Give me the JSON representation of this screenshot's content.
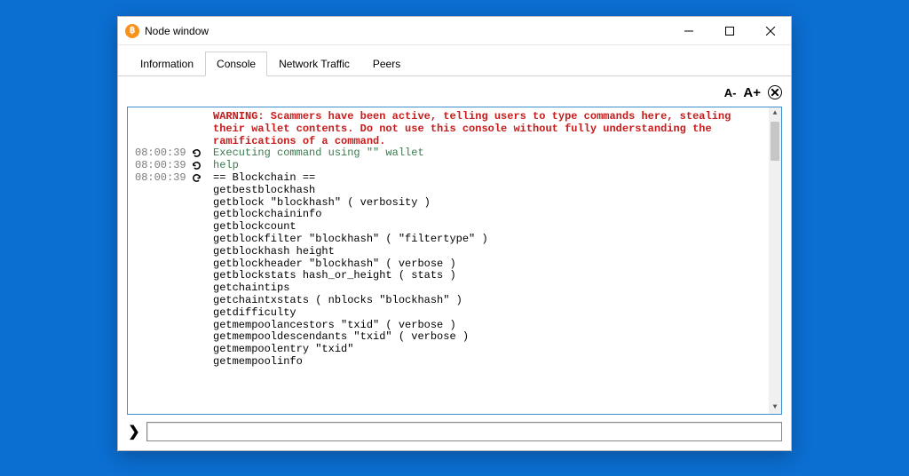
{
  "window": {
    "title": "Node window"
  },
  "tabs": [
    {
      "label": "Information",
      "active": false
    },
    {
      "label": "Console",
      "active": true
    },
    {
      "label": "Network Traffic",
      "active": false
    },
    {
      "label": "Peers",
      "active": false
    }
  ],
  "toolbar": {
    "font_dec": "A-",
    "font_inc": "A+"
  },
  "console": {
    "warning": "WARNING: Scammers have been active, telling users to type commands here, stealing their wallet contents. Do not use this console without fully understanding the ramifications of a command.",
    "rows": [
      {
        "ts": "08:00:39",
        "icon": "refresh",
        "class": "greenish",
        "text": "Executing command using \"\" wallet"
      },
      {
        "ts": "08:00:39",
        "icon": "refresh",
        "class": "greenish",
        "text": "help"
      },
      {
        "ts": "08:00:39",
        "icon": "in",
        "class": "",
        "text": "== Blockchain ==\ngetbestblockhash\ngetblock \"blockhash\" ( verbosity )\ngetblockchaininfo\ngetblockcount\ngetblockfilter \"blockhash\" ( \"filtertype\" )\ngetblockhash height\ngetblockheader \"blockhash\" ( verbose )\ngetblockstats hash_or_height ( stats )\ngetchaintips\ngetchaintxstats ( nblocks \"blockhash\" )\ngetdifficulty\ngetmempoolancestors \"txid\" ( verbose )\ngetmempooldescendants \"txid\" ( verbose )\ngetmempoolentry \"txid\"\ngetmempoolinfo"
      }
    ]
  },
  "input": {
    "value": ""
  }
}
